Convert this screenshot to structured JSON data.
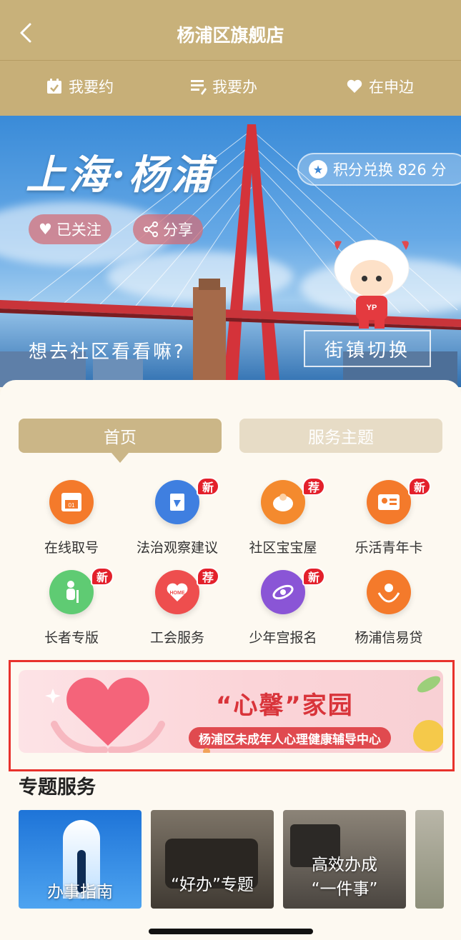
{
  "header": {
    "title": "杨浦区旗舰店"
  },
  "quick_actions": [
    {
      "label": "我要约",
      "icon": "calendar-check-icon"
    },
    {
      "label": "我要办",
      "icon": "document-list-icon"
    },
    {
      "label": "在申边",
      "icon": "heart-icon"
    }
  ],
  "banner": {
    "title": "上海·杨浦",
    "points_label": "积分兑换 826 分",
    "follow_label": "已关注",
    "share_label": "分享",
    "question": "想去社区看看嘛?",
    "switch_label": "街镇切换",
    "mascot_tag": "YP"
  },
  "tabs": [
    {
      "label": "首页",
      "active": true
    },
    {
      "label": "服务主题",
      "active": false
    }
  ],
  "services": [
    {
      "label": "在线取号",
      "icon": "ticket-machine-icon",
      "badge": "",
      "color": "#f47a2b"
    },
    {
      "label": "法治观察建议",
      "icon": "gavel-document-icon",
      "badge": "新",
      "color": "#3f7fe0"
    },
    {
      "label": "社区宝宝屋",
      "icon": "baby-icon",
      "badge": "荐",
      "color": "#f48a2e"
    },
    {
      "label": "乐活青年卡",
      "icon": "id-card-icon",
      "badge": "新",
      "color": "#f47a2b"
    },
    {
      "label": "长者专版",
      "icon": "elder-icon",
      "badge": "新",
      "color": "#5fcb73"
    },
    {
      "label": "工会服务",
      "icon": "home-heart-icon",
      "badge": "荐",
      "color": "#ee4e4e"
    },
    {
      "label": "少年宫报名",
      "icon": "orbit-icon",
      "badge": "新",
      "color": "#8a55d6"
    },
    {
      "label": "杨浦信易贷",
      "icon": "hands-money-icon",
      "badge": "",
      "color": "#f47a2b"
    }
  ],
  "promo": {
    "title": "“心馨”家园",
    "subtitle": "杨浦区未成年人心理健康辅导中心"
  },
  "section": {
    "title": "专题服务"
  },
  "topics": [
    {
      "label": "办事指南"
    },
    {
      "label_line1": "“好办”专题"
    },
    {
      "label_line1": "高效办成",
      "label_line2": "“一件事”"
    }
  ],
  "colors": {
    "header": "#c8b17a",
    "tab_active": "#cbb687",
    "badge": "#e3202b",
    "promo_accent": "#d9343a"
  }
}
